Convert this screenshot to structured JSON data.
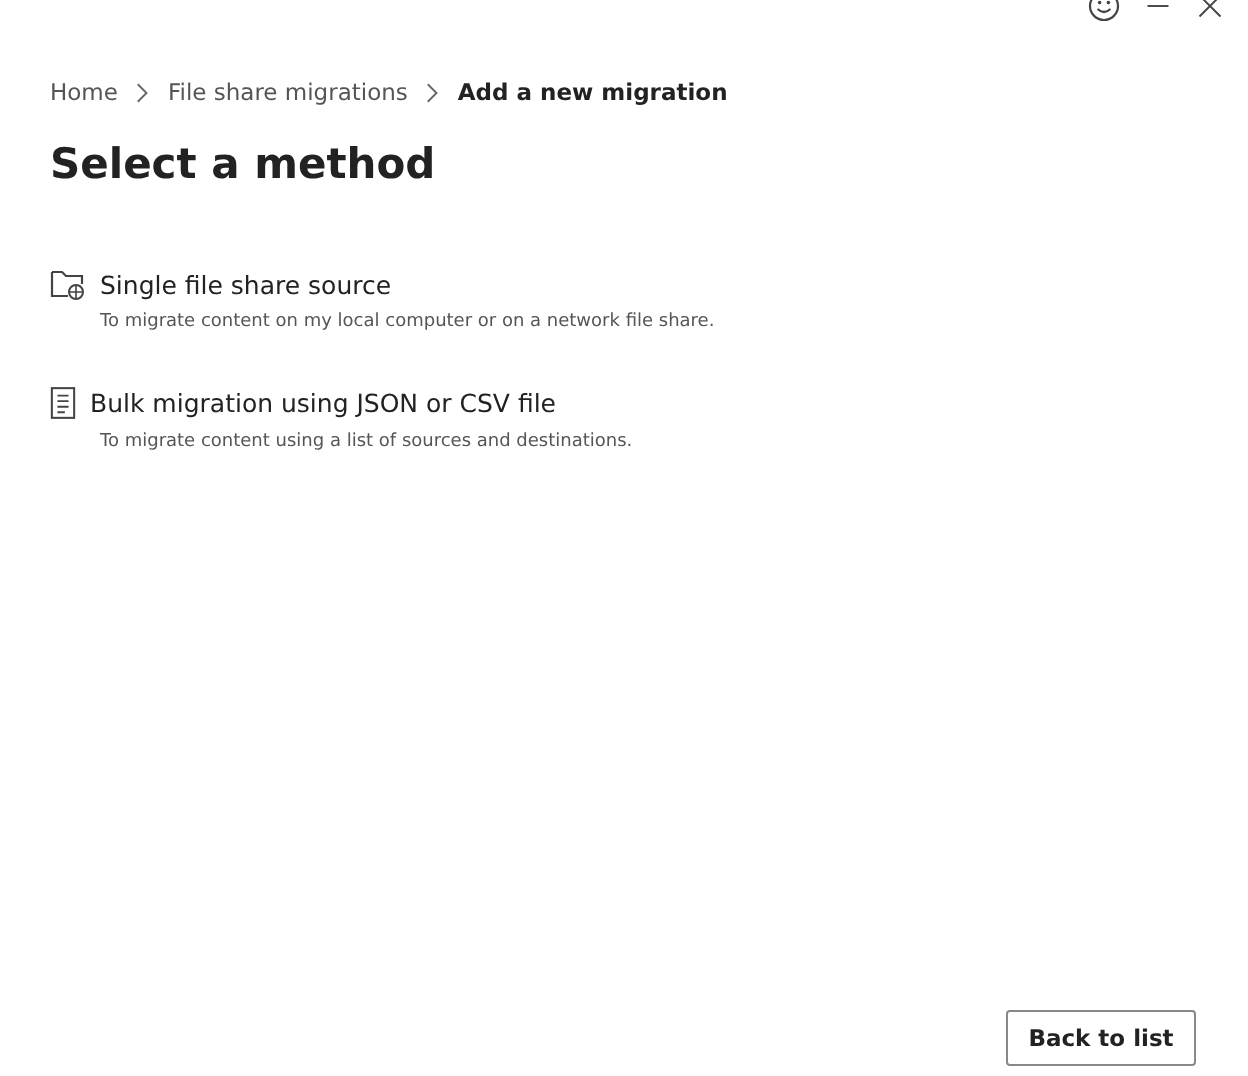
{
  "breadcrumb": [
    {
      "label": "Home",
      "current": false
    },
    {
      "label": "File share migrations",
      "current": false
    },
    {
      "label": "Add a new migration",
      "current": true
    }
  ],
  "title": "Select a method",
  "methods": [
    {
      "kind": "folder",
      "title": "Single file share source",
      "description": "To migrate content on my local computer or on a network file share."
    },
    {
      "kind": "list",
      "title": "Bulk migration using JSON or CSV file",
      "description": "To migrate content using a list of sources and destinations."
    }
  ],
  "buttons": [
    "Back to list"
  ]
}
